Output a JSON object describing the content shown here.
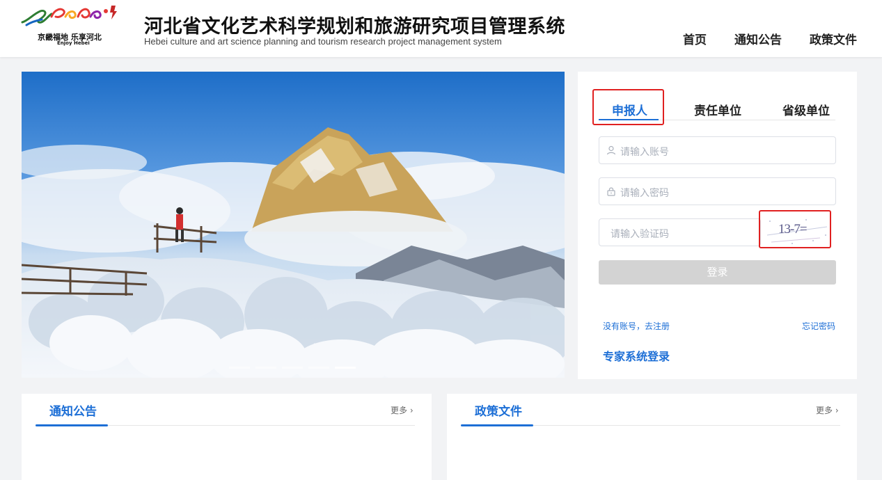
{
  "header": {
    "logo": {
      "script": "Hebei",
      "slogan_cn": "京畿福地 乐享河北",
      "slogan_en": "Enjoy Hebei"
    },
    "title_cn": "河北省文化艺术科学规划和旅游研究项目管理系统",
    "title_en": "Hebei culture and art science planning and tourism research project management system",
    "nav": [
      "首页",
      "通知公告",
      "政策文件"
    ]
  },
  "banner": {
    "slides": 5,
    "active_slide": 5
  },
  "login": {
    "tabs": [
      "申报人",
      "责任单位",
      "省级单位"
    ],
    "active_tab": 0,
    "account_placeholder": "请输入账号",
    "password_placeholder": "请输入密码",
    "captcha_placeholder": "请输入验证码",
    "captcha_text": "13-7=",
    "submit_label": "登录",
    "register_link": "没有账号，去注册",
    "forgot_link": "忘记密码",
    "expert_link": "专家系统登录"
  },
  "panels": [
    {
      "title": "通知公告",
      "more": "更多 ›"
    },
    {
      "title": "政策文件",
      "more": "更多 ›"
    }
  ],
  "colors": {
    "primary": "#1d6fd6",
    "highlight_box": "#e02020",
    "button_disabled": "#d3d3d3",
    "page_bg": "#f2f3f5"
  }
}
